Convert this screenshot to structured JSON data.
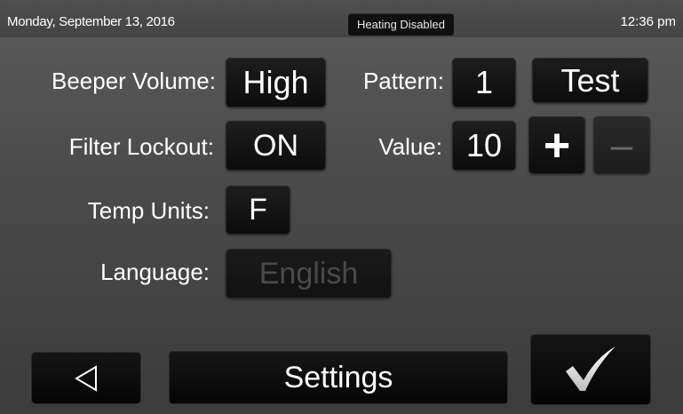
{
  "status": {
    "date": "Monday, September 13, 2016",
    "heating_status": "Heating Disabled",
    "time": "12:36 pm"
  },
  "settings": {
    "beeper_volume_label": "Beeper Volume:",
    "beeper_volume_value": "High",
    "pattern_label": "Pattern:",
    "pattern_value": "1",
    "test_label": "Test",
    "filter_lockout_label": "Filter Lockout:",
    "filter_lockout_value": "ON",
    "value_label": "Value:",
    "value_value": "10",
    "plus_label": "+",
    "minus_label": "–",
    "temp_units_label": "Temp Units:",
    "temp_units_value": "F",
    "language_label": "Language:",
    "language_value": "English"
  },
  "footer": {
    "title": "Settings",
    "back_icon": "back-triangle-icon",
    "confirm_icon": "checkmark-icon"
  },
  "colors": {
    "background": "#4a4a4a",
    "button": "#101010",
    "text": "#ffffff",
    "disabled_text": "#4a4a4a"
  }
}
